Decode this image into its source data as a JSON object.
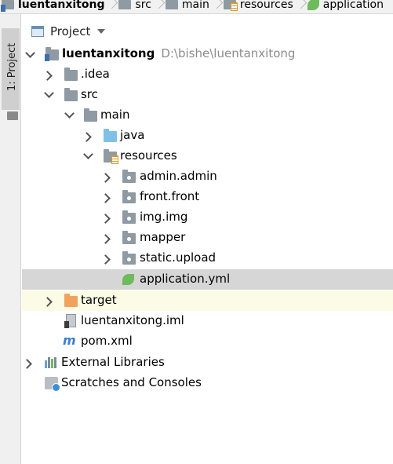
{
  "breadcrumb": {
    "items": [
      "luentanxitong",
      "src",
      "main",
      "resources",
      "application"
    ]
  },
  "sidebar": {
    "tab_label": "1: Project"
  },
  "project_panel": {
    "title": "Project"
  },
  "tree": {
    "root": {
      "label": "luentanxitong",
      "path": "D:\\bishe\\luentanxitong"
    },
    "idea": ".idea",
    "src": "src",
    "main": "main",
    "java": "java",
    "resources": "resources",
    "res_children": [
      "admin.admin",
      "front.front",
      "img.img",
      "mapper",
      "static.upload"
    ],
    "app_yml": "application.yml",
    "target": "target",
    "iml": "luentanxitong.iml",
    "pom": "pom.xml",
    "external": "External Libraries",
    "scratches": "Scratches and Consoles"
  },
  "icons": {
    "folder": "folder-icon",
    "module": "module-folder-icon",
    "spring": "spring-leaf-icon",
    "maven": "maven-m-icon",
    "library": "library-icon",
    "scratch": "scratch-icon"
  },
  "colors": {
    "selected_row": "#d6d6d6",
    "excluded_row": "#fcfbe6",
    "source_folder": "#7fc1e6",
    "excluded_folder": "#f0a35e"
  }
}
